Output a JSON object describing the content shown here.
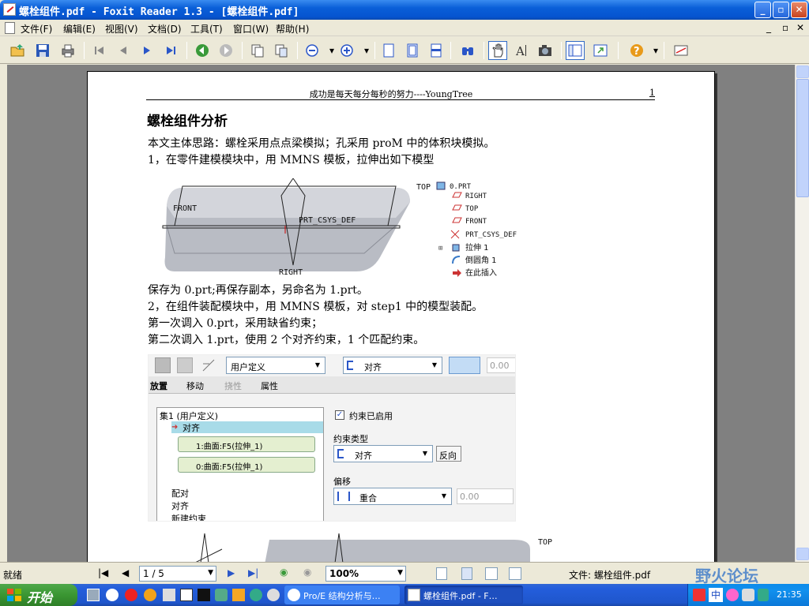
{
  "window": {
    "title": "螺栓组件.pdf - Foxit Reader 1.3 - [螺栓组件.pdf]"
  },
  "menu": {
    "items": [
      "文件(F)",
      "编辑(E)",
      "视图(V)",
      "文档(D)",
      "工具(T)",
      "窗口(W)",
      "帮助(H)"
    ]
  },
  "page": {
    "header_text": "成功是每天每分每秒的努力----YoungTree",
    "header_page": "1",
    "heading": "螺栓组件分析",
    "paragraphs": [
      "本文主体思路：螺栓采用点点梁模拟；孔采用 proM 中的体积块模拟。",
      "1，在零件建模模块中，用 MMNS 模板，拉伸出如下模型",
      " 保存为 0.prt;再保存副本，另命名为 1.prt。",
      "2，在组件装配模块中，用 MMNS 模板，对 step1 中的模型装配。",
      "第一次调入 0.prt，采用缺省约束；",
      "第二次调入 1.prt，使用 2 个对齐约束，1 个匹配约束。"
    ],
    "figure1": {
      "labels": [
        "FRONT",
        "PRT_CSYS_DEF",
        "TOP",
        "RIGHT"
      ],
      "tree": [
        "0.PRT",
        "RIGHT",
        "TOP",
        "FRONT",
        "PRT_CSYS_DEF",
        "拉伸 1",
        "倒圆角 1",
        "在此插入"
      ]
    },
    "figure2": {
      "user_defined": "用户定义",
      "align": "对齐",
      "offset_value": "0.00",
      "tabs": [
        "放置",
        "移动",
        "挠性",
        "属性"
      ],
      "set_title": "集1 (用户定义)",
      "set_current": "对齐",
      "ref1": "1:曲面:F5(拉伸_1)",
      "ref0": "0:曲面:F5(拉伸_1)",
      "list": [
        "配对",
        "对齐",
        "新建约束"
      ],
      "enabled": "约束已启用",
      "type_label": "约束类型",
      "type_value": "对齐",
      "flip": "反向",
      "offset_label": "偏移",
      "offset_mode": "重合",
      "offset_value2": "0.00"
    },
    "figure3": {
      "label": "TOP"
    }
  },
  "status": {
    "ready": "就绪",
    "page_box": "1 / 5",
    "zoom": "100%",
    "file": "文件: 螺栓组件.pdf",
    "watermark": "野火论坛"
  },
  "taskbar": {
    "start": "开始",
    "tasks": [
      "Pro/E 结构分析与…",
      "螺栓组件.pdf - F…"
    ],
    "ime": "中",
    "clock": "21:35"
  }
}
